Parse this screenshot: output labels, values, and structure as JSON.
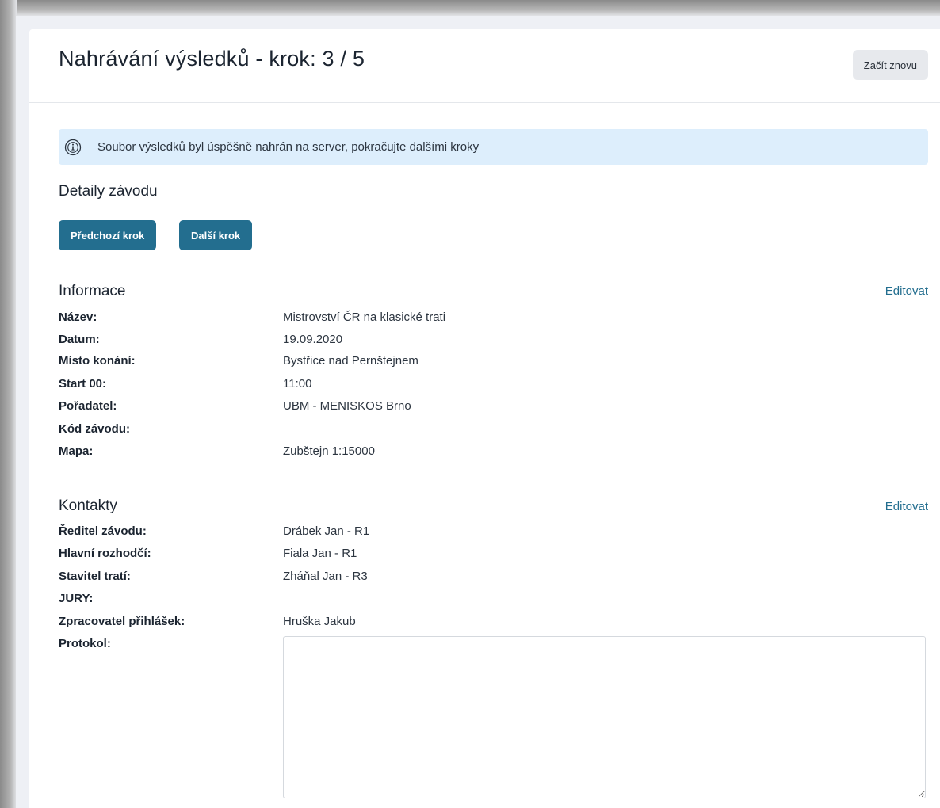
{
  "header": {
    "title": "Nahrávání výsledků - krok: 3 / 5",
    "restart_label": "Začít znovu"
  },
  "alert": {
    "icon": "info-icon",
    "message": "Soubor výsledků byl úspěšně nahrán na server, pokračujte dalšími kroky"
  },
  "race_details": {
    "heading": "Detaily závodu",
    "prev_label": "Předchozí krok",
    "next_label": "Další krok"
  },
  "information": {
    "heading": "Informace",
    "edit_label": "Editovat",
    "rows": [
      {
        "label": "Název:",
        "value": "Mistrovství ČR na klasické trati"
      },
      {
        "label": "Datum:",
        "value": "19.09.2020"
      },
      {
        "label": "Místo konání:",
        "value": "Bystřice nad Pernštejnem"
      },
      {
        "label": "Start 00:",
        "value": "11:00"
      },
      {
        "label": "Pořadatel:",
        "value": "UBM - MENISKOS Brno"
      },
      {
        "label": "Kód závodu:",
        "value": ""
      },
      {
        "label": "Mapa:",
        "value": "Zubštejn 1:15000"
      }
    ]
  },
  "contacts": {
    "heading": "Kontakty",
    "edit_label": "Editovat",
    "rows": [
      {
        "label": "Ředitel závodu:",
        "value": "Drábek Jan - R1"
      },
      {
        "label": "Hlavní rozhodčí:",
        "value": "Fiala Jan - R1"
      },
      {
        "label": "Stavitel tratí:",
        "value": "Zháňal Jan - R3"
      },
      {
        "label": "JURY:",
        "value": ""
      },
      {
        "label": "Zpracovatel přihlášek:",
        "value": "Hruška Jakub"
      },
      {
        "label": "Protokol:",
        "value": ""
      }
    ],
    "protocol_value": ""
  },
  "colors": {
    "primary": "#236e8f",
    "alert_bg": "#ddeefc",
    "page_bg": "#eef0f5"
  }
}
